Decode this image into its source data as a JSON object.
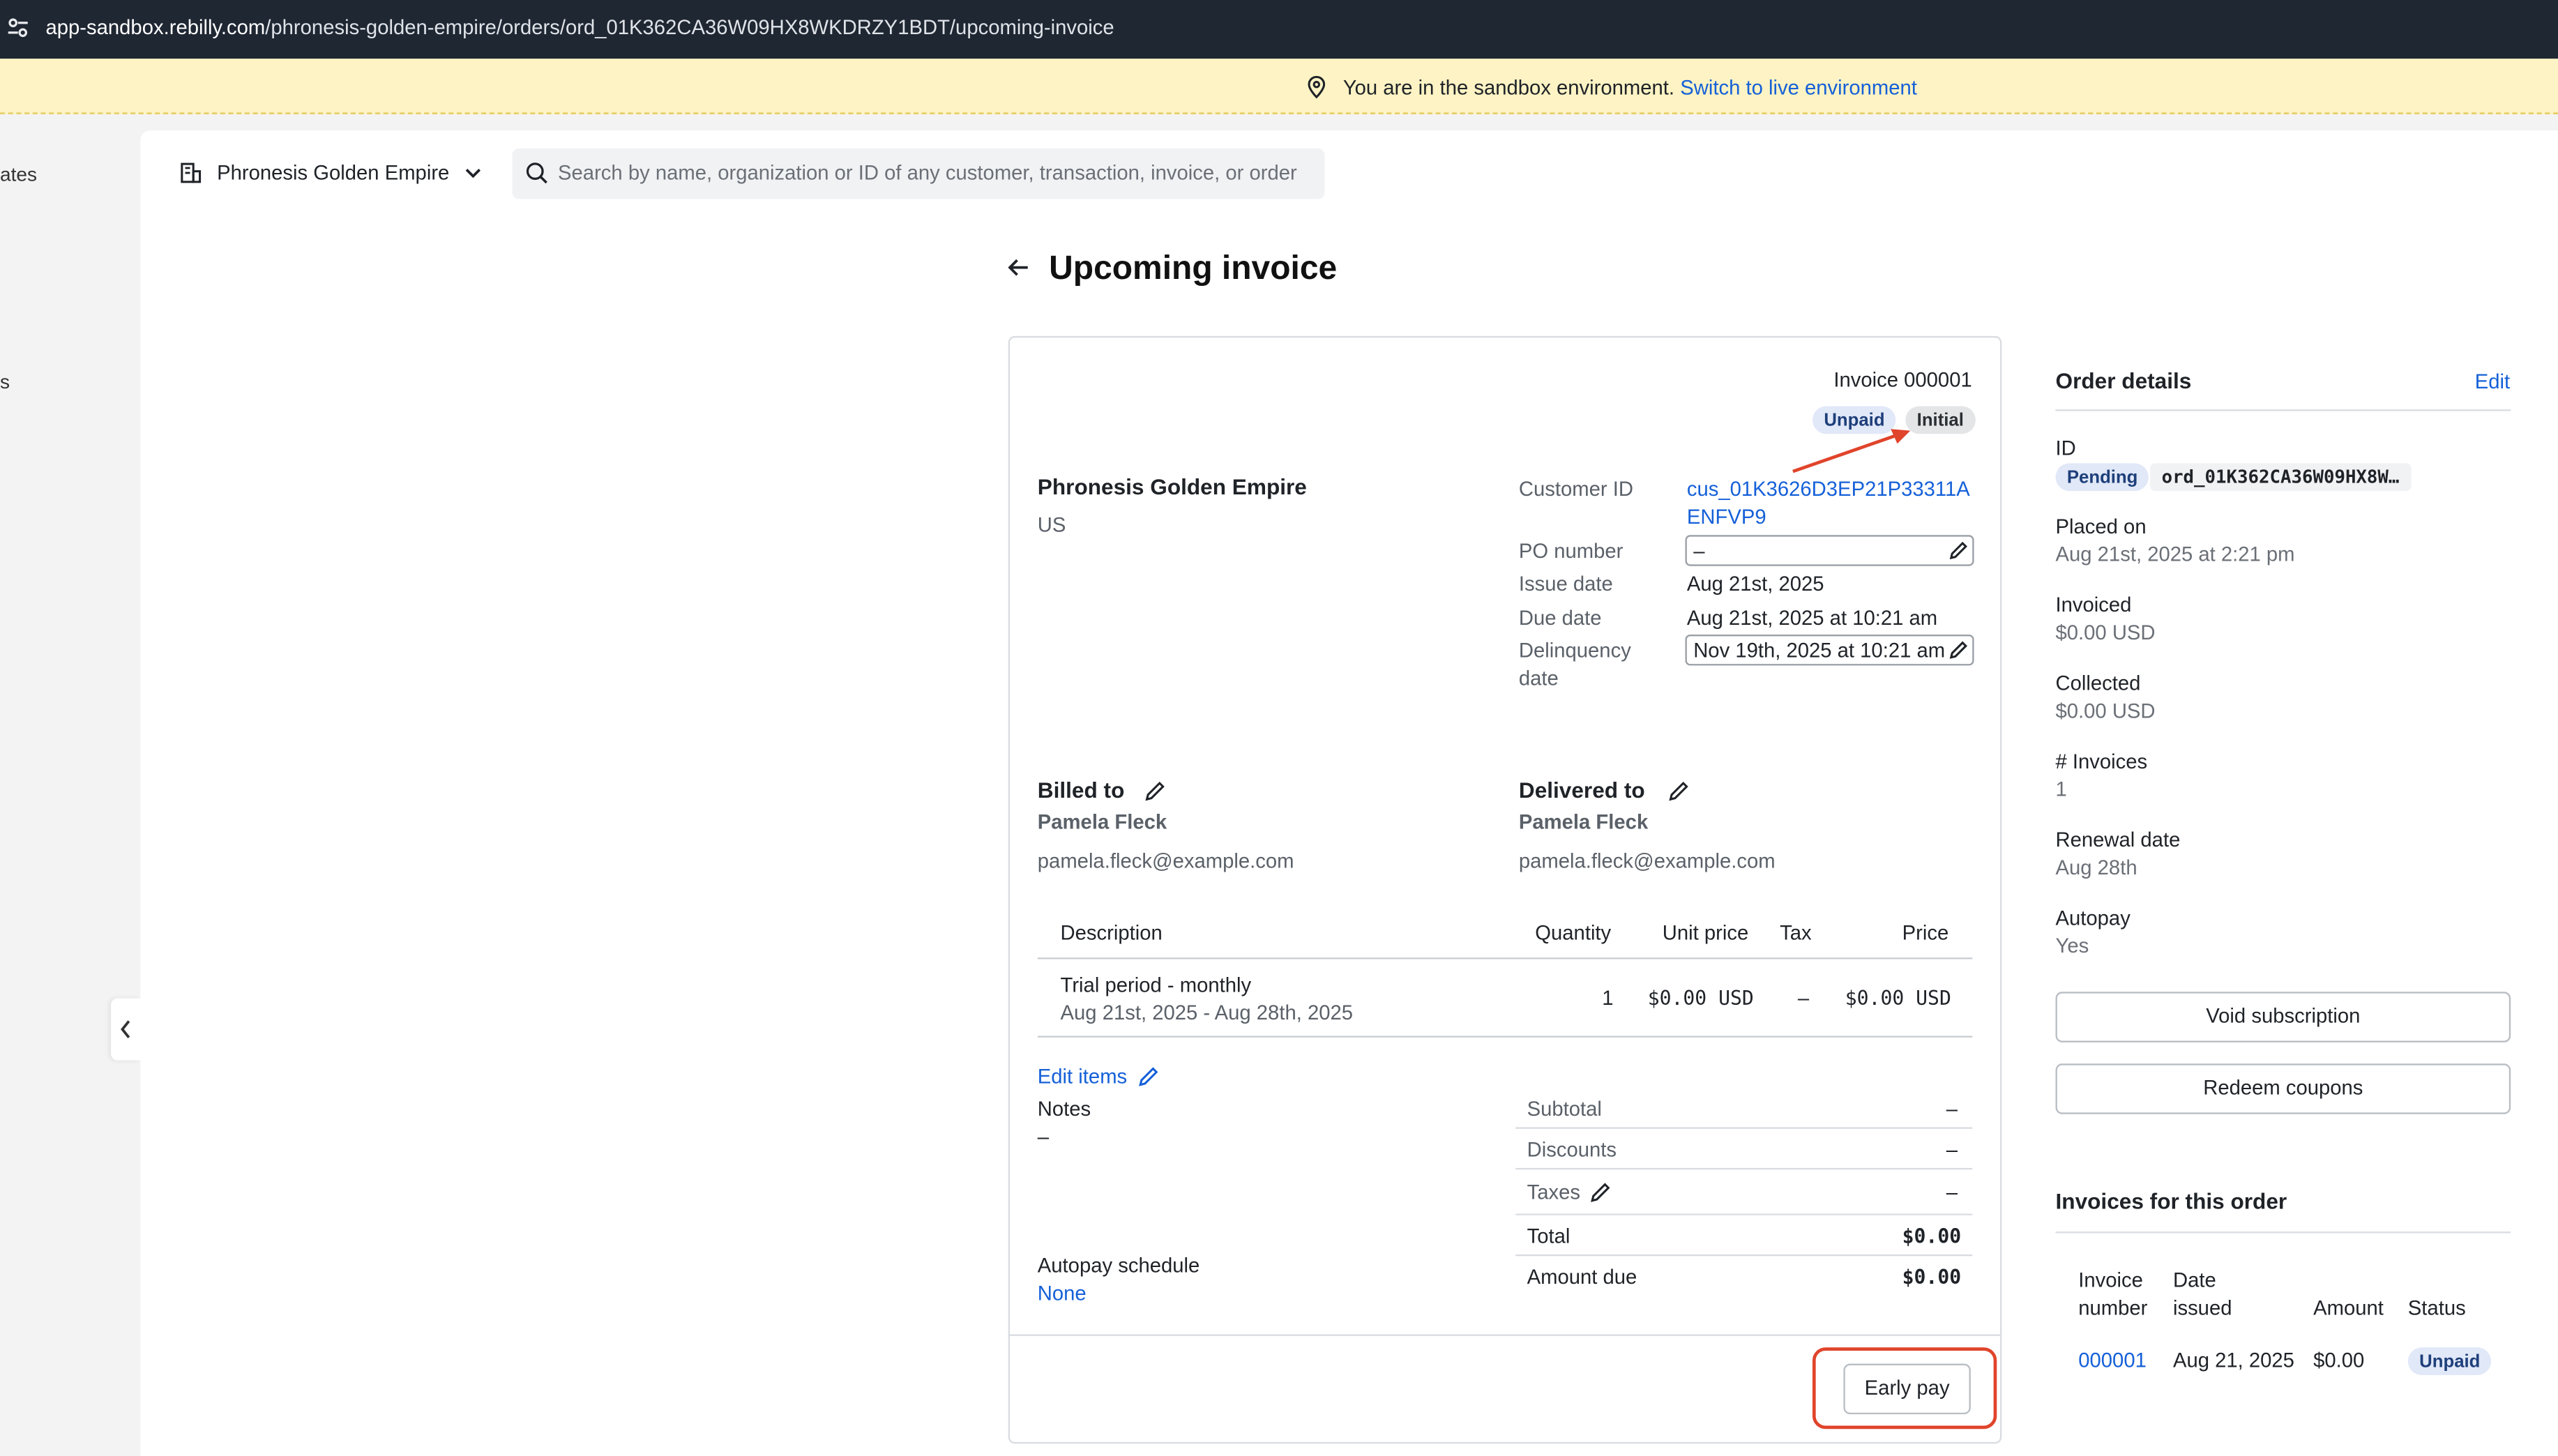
{
  "browser": {
    "url_host": "app-sandbox.rebilly.com",
    "url_path": "/phronesis-golden-empire/orders/ord_01K362CA36W09HX8WKDRZY1BDT/upcoming-invoice"
  },
  "banner": {
    "text": "You are in the sandbox environment.",
    "link": "Switch to live environment"
  },
  "nav": {
    "partial_1": "ates",
    "partial_2": "s"
  },
  "header": {
    "org_name": "Phronesis Golden Empire",
    "search_placeholder": "Search by name, organization or ID of any customer, transaction, invoice, or order"
  },
  "page": {
    "title": "Upcoming invoice"
  },
  "invoice": {
    "number_label": "Invoice 000001",
    "badges": [
      "Unpaid",
      "Initial"
    ],
    "seller_name": "Phronesis Golden Empire",
    "seller_country": "US",
    "customer_id_label": "Customer ID",
    "customer_id_line1": "cus_01K3626D3EP21P33311A",
    "customer_id_line2": "ENFVP9",
    "po_label": "PO number",
    "po_value": "–",
    "issue_label": "Issue date",
    "issue_value": "Aug 21st, 2025",
    "due_label": "Due date",
    "due_value": "Aug 21st, 2025 at 10:21 am",
    "delinquency_label_1": "Delinquency",
    "delinquency_label_2": "date",
    "delinquency_value": "Nov 19th, 2025 at 10:21 am",
    "billed_title": "Billed to",
    "billed_name": "Pamela Fleck",
    "billed_email": "pamela.fleck@example.com",
    "delivered_title": "Delivered to",
    "delivered_name": "Pamela Fleck",
    "delivered_email": "pamela.fleck@example.com",
    "columns": {
      "description": "Description",
      "quantity": "Quantity",
      "unit_price": "Unit price",
      "tax": "Tax",
      "price": "Price"
    },
    "items": [
      {
        "description": "Trial period - monthly",
        "period": "Aug 21st, 2025 - Aug 28th, 2025",
        "quantity": "1",
        "unit_price": "$0.00 USD",
        "tax": "–",
        "price": "$0.00 USD"
      }
    ],
    "edit_items": "Edit items",
    "notes_label": "Notes",
    "notes_value": "–",
    "autopay_label": "Autopay schedule",
    "autopay_value": "None",
    "totals": {
      "subtotal_label": "Subtotal",
      "subtotal_value": "–",
      "discounts_label": "Discounts",
      "discounts_value": "–",
      "taxes_label": "Taxes",
      "taxes_value": "–",
      "total_label": "Total",
      "total_value": "$0.00",
      "amount_due_label": "Amount due",
      "amount_due_value": "$0.00"
    },
    "early_pay": "Early pay"
  },
  "order": {
    "title": "Order details",
    "edit": "Edit",
    "id_label": "ID",
    "id_status": "Pending",
    "id_value": "ord_01K362CA36W09HX8W…",
    "placed_label": "Placed on",
    "placed_value": "Aug 21st, 2025 at 2:21 pm",
    "invoiced_label": "Invoiced",
    "invoiced_value": "$0.00 USD",
    "collected_label": "Collected",
    "collected_value": "$0.00 USD",
    "invoices_count_label": "# Invoices",
    "invoices_count_value": "1",
    "renewal_label": "Renewal date",
    "renewal_value": "Aug 28th",
    "autopay_label": "Autopay",
    "autopay_value": "Yes",
    "void_button": "Void subscription",
    "redeem_button": "Redeem coupons"
  },
  "order_invoices": {
    "title": "Invoices for this order",
    "col_number_1": "Invoice",
    "col_number_2": "number",
    "col_date_1": "Date",
    "col_date_2": "issued",
    "col_amount": "Amount",
    "col_status": "Status",
    "rows": [
      {
        "number": "000001",
        "date": "Aug 21, 2025",
        "amount": "$0.00",
        "status": "Unpaid"
      }
    ]
  },
  "colors": {
    "link": "#1560d8",
    "annotation": "#e0442b",
    "banner": "#fdf3c4"
  }
}
